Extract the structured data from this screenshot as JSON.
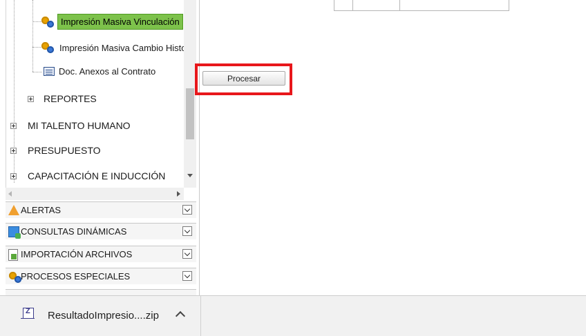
{
  "sidebar": {
    "tree": {
      "items": [
        {
          "label": "Impresión Masiva Vinculación",
          "icon": "gear-process-icon",
          "selected": true
        },
        {
          "label": "Impresión Masiva Cambio Histo",
          "icon": "gear-process-icon",
          "selected": false
        },
        {
          "label": "Doc. Anexos al Contrato",
          "icon": "document-list-icon",
          "selected": false
        },
        {
          "label": "REPORTES",
          "icon": "expand-plus-icon",
          "selected": false
        },
        {
          "label": "MI TALENTO HUMANO",
          "icon": "expand-plus-icon",
          "selected": false
        },
        {
          "label": "PRESUPUESTO",
          "icon": "expand-plus-icon",
          "selected": false
        },
        {
          "label": "CAPACITACIÓN E INDUCCIÓN",
          "icon": "expand-plus-icon",
          "selected": false
        }
      ]
    },
    "panels": [
      {
        "label": "ALERTAS",
        "icon": "warning-icon"
      },
      {
        "label": "CONSULTAS DINÁMICAS",
        "icon": "dynamic-query-icon"
      },
      {
        "label": "IMPORTACIÓN ARCHIVOS",
        "icon": "import-file-icon"
      },
      {
        "label": "PROCESOS ESPECIALES",
        "icon": "gear-process-icon"
      }
    ]
  },
  "main": {
    "process_button": "Procesar",
    "highlight_color": "#e8171b"
  },
  "download_bar": {
    "file_name": "ResultadoImpresio....zip",
    "icon": "zip-file-icon"
  },
  "colors": {
    "selected_item": "#7dc24b",
    "panel_bg": "#f5f5f5"
  }
}
